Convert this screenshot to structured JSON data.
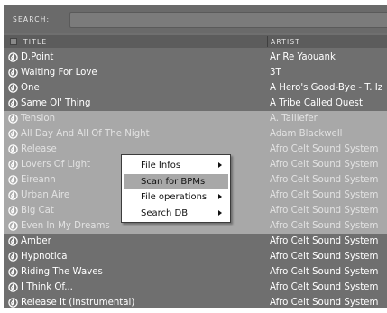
{
  "search": {
    "label": "SEARCH:",
    "value": "",
    "placeholder": ""
  },
  "columns": {
    "title": "TITLE",
    "artist": "ARTIST"
  },
  "tracks": [
    {
      "title": "D.Point",
      "artist": "Ar Re Yaouank",
      "selected": false
    },
    {
      "title": "Waiting For Love",
      "artist": "3T",
      "selected": false
    },
    {
      "title": "One",
      "artist": "A Hero's Good-Bye - T. Iz",
      "selected": false
    },
    {
      "title": "Same Ol' Thing",
      "artist": "A Tribe Called Quest",
      "selected": false
    },
    {
      "title": "Tension",
      "artist": "A. Taillefer",
      "selected": true
    },
    {
      "title": "All Day And All Of The Night",
      "artist": "Adam Blackwell",
      "selected": true
    },
    {
      "title": "Release",
      "artist": "Afro Celt Sound System",
      "selected": true
    },
    {
      "title": "Lovers Of Light",
      "artist": "Afro Celt Sound System",
      "selected": true
    },
    {
      "title": "Eireann",
      "artist": "Afro Celt Sound System",
      "selected": true
    },
    {
      "title": "Urban Aire",
      "artist": "Afro Celt Sound System",
      "selected": true
    },
    {
      "title": "Big Cat",
      "artist": "Afro Celt Sound System",
      "selected": true
    },
    {
      "title": "Even In My Dreams",
      "artist": "Afro Celt Sound System",
      "selected": true
    },
    {
      "title": "Amber",
      "artist": "Afro Celt Sound System",
      "selected": false
    },
    {
      "title": "Hypnotica",
      "artist": "Afro Celt Sound System",
      "selected": false
    },
    {
      "title": "Riding The Waves",
      "artist": "Afro Celt Sound System",
      "selected": false
    },
    {
      "title": "I Think Of...",
      "artist": "Afro Celt Sound System",
      "selected": false
    },
    {
      "title": "Release It (Instrumental)",
      "artist": "Afro Celt Sound System",
      "selected": false
    }
  ],
  "context_menu": {
    "items": [
      {
        "label": "File Infos",
        "submenu": true,
        "active": false
      },
      {
        "label": "Scan for BPMs",
        "submenu": false,
        "active": true
      },
      {
        "label": "File operations",
        "submenu": true,
        "active": false
      },
      {
        "label": "Search DB",
        "submenu": true,
        "active": false
      }
    ]
  },
  "icons": {
    "track": "music-disc-icon",
    "submenu": "submenu-arrow-icon"
  },
  "colors": {
    "panel": "#6f6f6f",
    "selection": "#a8a8a8",
    "menu_bg": "#ffffff",
    "menu_highlight": "#a8a8a8"
  }
}
